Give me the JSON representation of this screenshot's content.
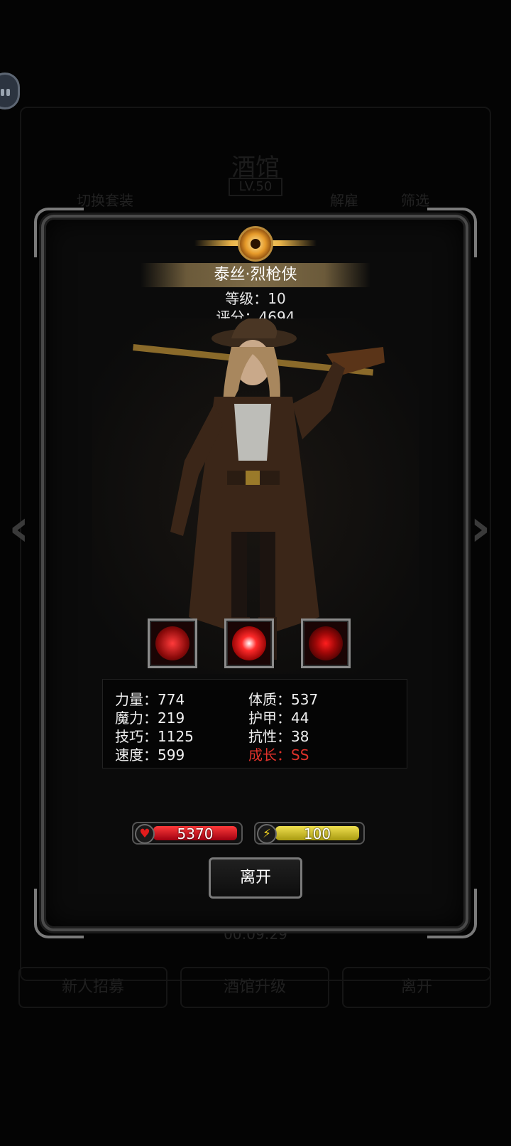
{
  "background": {
    "title": "酒馆",
    "level": "LV.50",
    "tabs": [
      "切换套装",
      "解雇",
      "筛选"
    ],
    "timer": "00:09:29",
    "buttons": [
      "新人招募",
      "酒馆升级",
      "离开"
    ]
  },
  "hero": {
    "name": "泰丝·烈枪侠",
    "level": "等级：10",
    "score": "评分：4694"
  },
  "skills": [
    {
      "icon": "crosshair-skill-icon"
    },
    {
      "icon": "swirl-skill-icon"
    },
    {
      "icon": "target-skill-icon"
    }
  ],
  "stats": {
    "strength": "力量：774",
    "magic": "魔力：219",
    "skill": "技巧：1125",
    "speed": "速度：599",
    "constitution": "体质：537",
    "armor": "护甲：44",
    "resistance": "抗性：38",
    "growth": "成长：SS"
  },
  "bars": {
    "hp": "5370",
    "energy": "100"
  },
  "leave_label": "离开",
  "colors": {
    "growth_red": "#e0322b",
    "hp_red": "#c8101a",
    "energy_yellow": "#d4c21a",
    "crest_gold": "#e8b34a"
  }
}
